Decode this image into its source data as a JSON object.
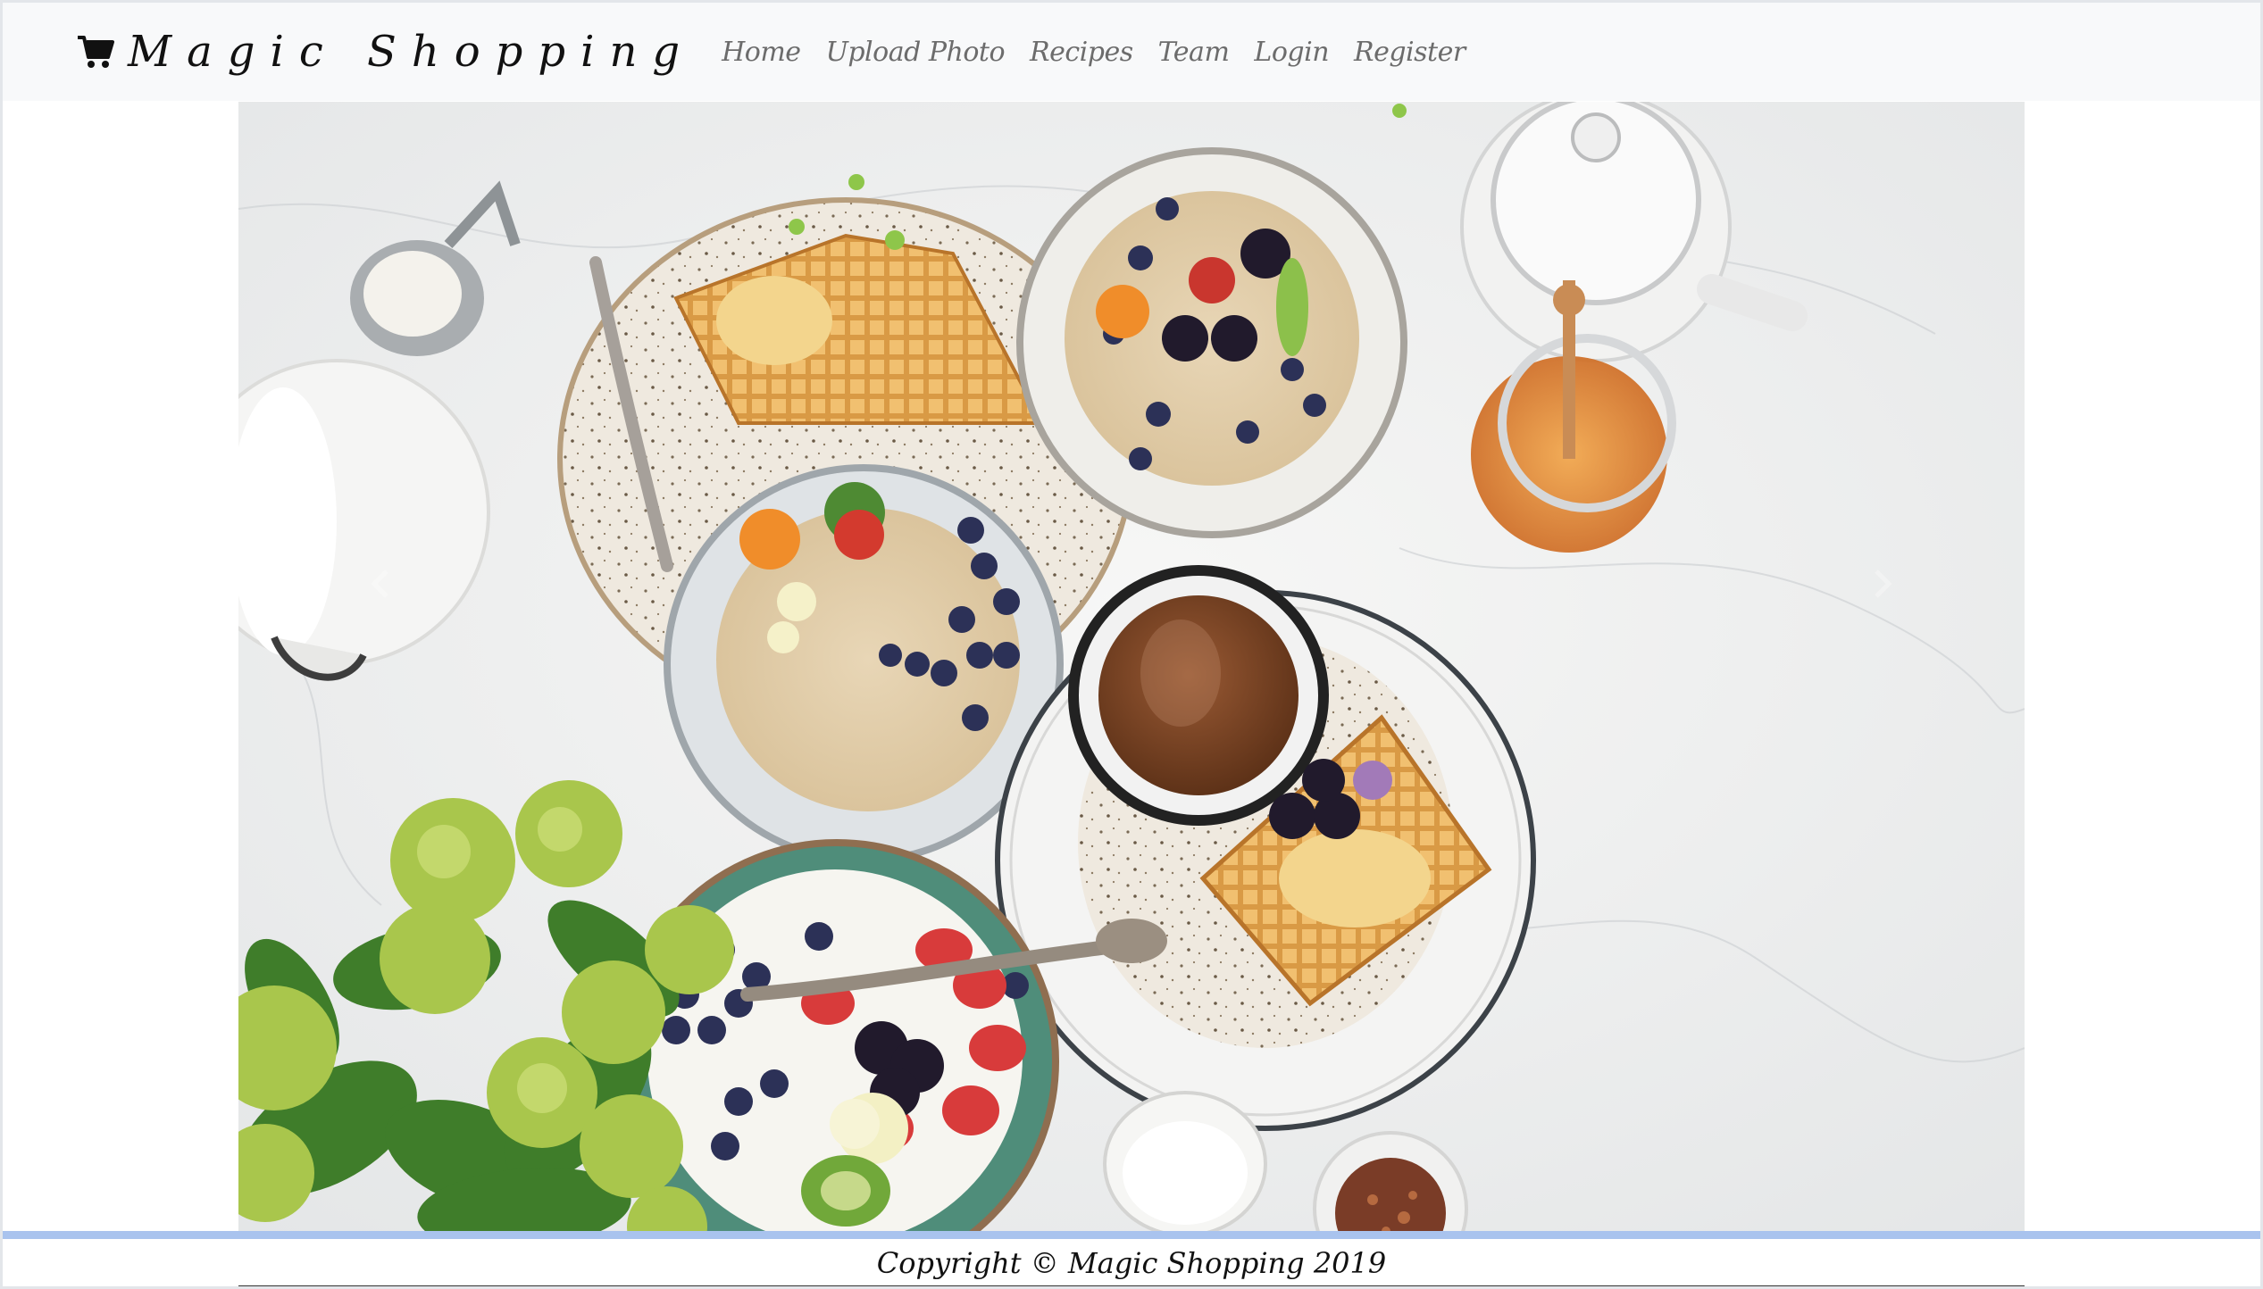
{
  "brand": {
    "name": "Magic Shopping",
    "icon": "shopping-cart-icon"
  },
  "nav": {
    "items": [
      {
        "label": "Home"
      },
      {
        "label": "Upload Photo"
      },
      {
        "label": "Recipes"
      },
      {
        "label": "Team"
      },
      {
        "label": "Login"
      },
      {
        "label": "Register"
      }
    ]
  },
  "hero": {
    "image": "breakfast-table-photo",
    "prev_icon": "chevron-left-icon",
    "next_icon": "chevron-right-icon"
  },
  "footer": {
    "copyright": "Copyright © Magic Shopping 2019"
  },
  "colors": {
    "navbar_bg": "#f8f9fa",
    "footer_rule": "#a9c3ee",
    "brand_text": "#111111",
    "nav_text": "#6c6c6c"
  }
}
